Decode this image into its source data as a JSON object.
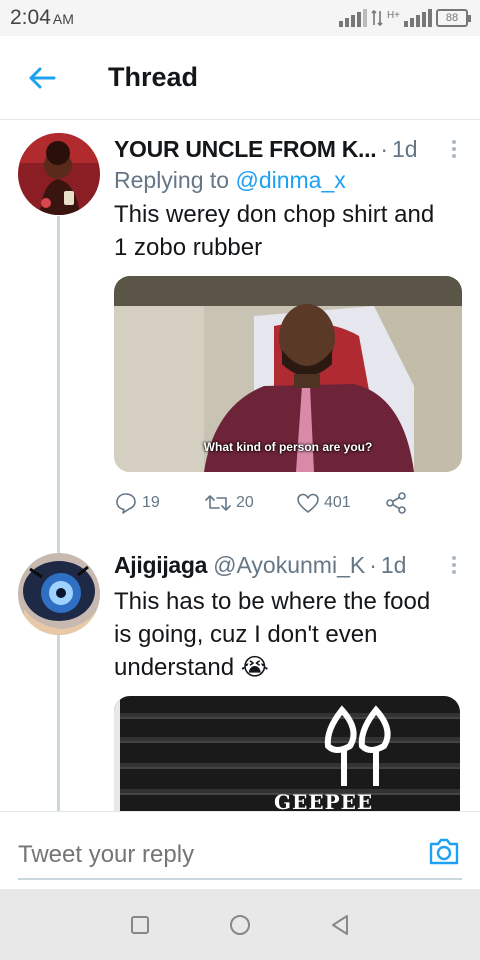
{
  "status_bar": {
    "time": "2:04",
    "ampm": "AM",
    "network_label": "H+",
    "battery": "88"
  },
  "header": {
    "title": "Thread"
  },
  "tweets": [
    {
      "name": "YOUR UNCLE FROM K...",
      "handle": "",
      "age": "1d",
      "replying_prefix": "Replying to ",
      "replying_to": "@dinma_x",
      "text_line1": "This werey don chop shirt and",
      "text_line2": "1 zobo rubber",
      "media_caption": "What kind of person are you?",
      "replies": "19",
      "retweets": "20",
      "likes": "401"
    },
    {
      "name": "Ajigijaga",
      "handle": "@Ayokunmi_K",
      "age": "1d",
      "text_line1": "This has to be where the food",
      "text_line2": "is going, cuz I don't even",
      "text_line3": "understand",
      "emoji": "😭",
      "media_caption": "GEEPEE"
    }
  ],
  "reply_bar": {
    "placeholder": "Tweet your reply"
  },
  "colors": {
    "accent": "#1da1f2",
    "secondary_text": "#657786",
    "thread_line": "#ccd6dd"
  },
  "icons": {
    "back": "arrow-left-icon",
    "more": "more-vertical-icon",
    "reply": "comment-icon",
    "retweet": "retweet-icon",
    "like": "heart-icon",
    "share": "share-icon",
    "camera": "camera-icon",
    "nav_recents": "square-icon",
    "nav_home": "circle-icon",
    "nav_back": "triangle-back-icon"
  }
}
